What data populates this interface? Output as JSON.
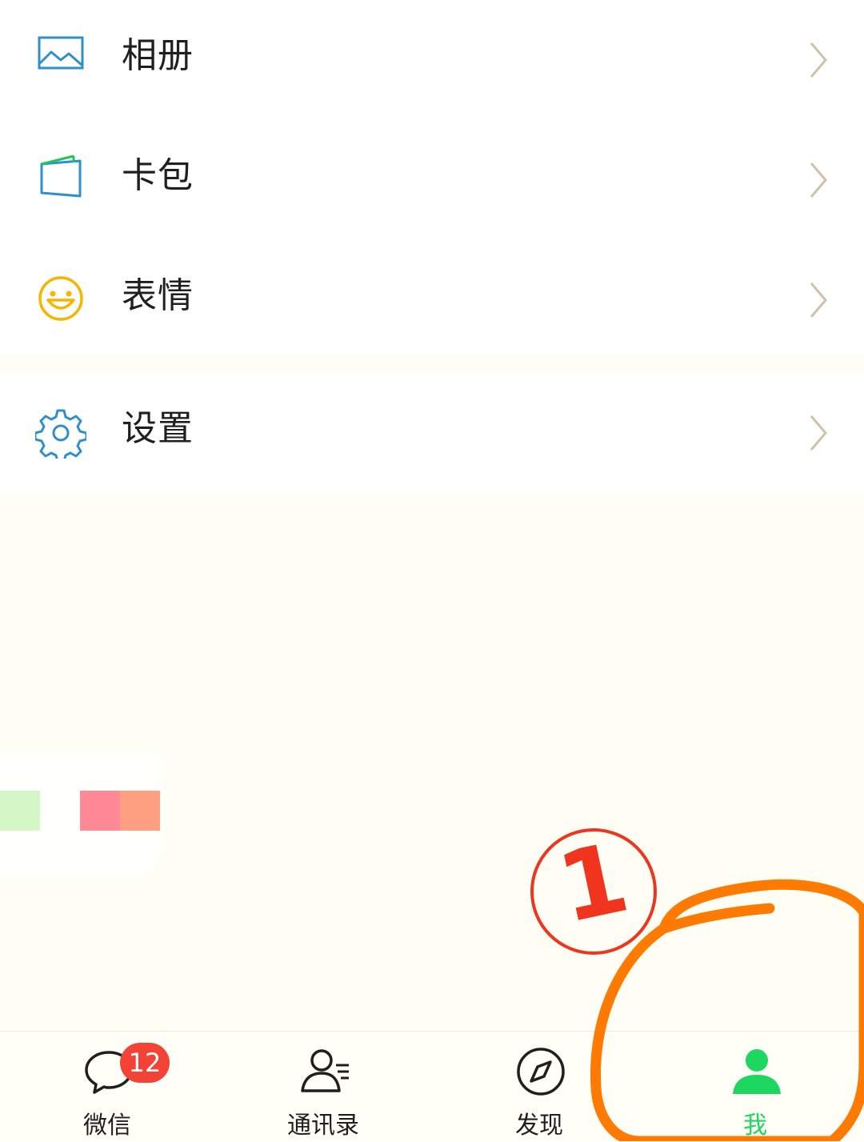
{
  "menu": {
    "items": [
      {
        "label": "相册",
        "icon": "album-icon"
      },
      {
        "label": "卡包",
        "icon": "card-wallet-icon"
      },
      {
        "label": "表情",
        "icon": "emoji-icon"
      },
      {
        "label": "设置",
        "icon": "settings-gear-icon"
      }
    ]
  },
  "tabbar": {
    "tabs": [
      {
        "label": "微信",
        "icon": "chat-bubble-icon",
        "badge": "12"
      },
      {
        "label": "通讯录",
        "icon": "contacts-icon"
      },
      {
        "label": "发现",
        "icon": "compass-icon"
      },
      {
        "label": "我",
        "icon": "person-icon",
        "active": true
      }
    ]
  },
  "annotation": {
    "step_number": "1"
  },
  "colors": {
    "accent_green": "#1ed760",
    "badge_red": "#f24336",
    "annotation_red": "#f0341e",
    "annotation_orange": "#ff7a00",
    "chevron": "#cfc2a8",
    "icon_blue": "#2f8fcc",
    "emoji_yellow": "#f7b500"
  }
}
